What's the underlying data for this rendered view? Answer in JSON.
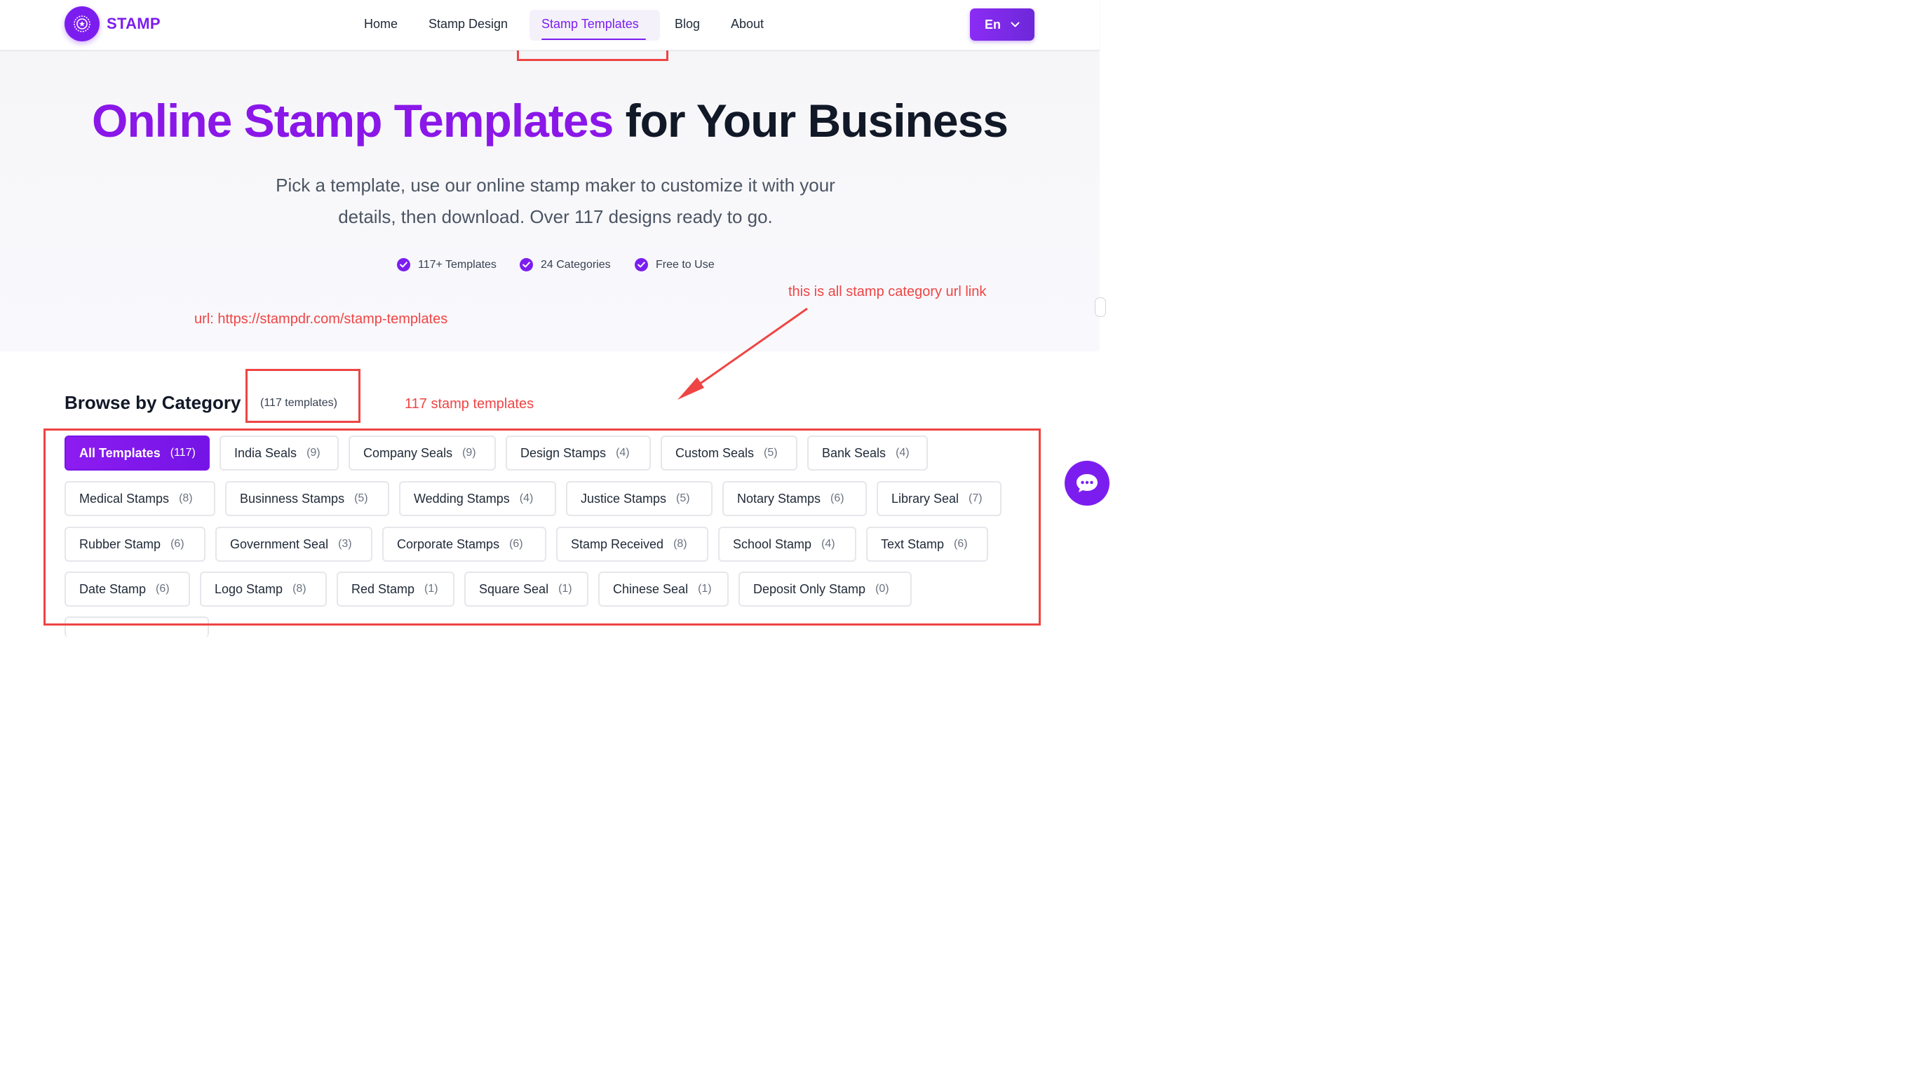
{
  "header": {
    "brand": "STAMP",
    "nav": [
      {
        "label": "Home"
      },
      {
        "label": "Stamp Design"
      },
      {
        "label": "Stamp Templates"
      },
      {
        "label": "Blog"
      },
      {
        "label": "About"
      }
    ],
    "language": "En"
  },
  "hero": {
    "title_accent": "Online Stamp Templates",
    "title_rest": "for Your Business",
    "subtitle": "Pick a template, use our online stamp maker to customize it with your details, then download. Over 117 designs ready to go.",
    "features": [
      "117+ Templates",
      "24 Categories",
      "Free to Use"
    ]
  },
  "annotations": {
    "url_note": "url: https://stampdr.com/stamp-templates",
    "category_note": "this is all stamp category url link",
    "count_note": "117 stamp templates"
  },
  "browse": {
    "title": "Browse by Category",
    "count": "(117 templates)",
    "categories": [
      {
        "label": "All Templates",
        "count": "(117)"
      },
      {
        "label": "India Seals",
        "count": "(9)"
      },
      {
        "label": "Company Seals",
        "count": "(9)"
      },
      {
        "label": "Design Stamps",
        "count": "(4)"
      },
      {
        "label": "Custom Seals",
        "count": "(5)"
      },
      {
        "label": "Bank Seals",
        "count": "(4)"
      },
      {
        "label": "Medical Stamps",
        "count": "(8)"
      },
      {
        "label": "Businness Stamps",
        "count": "(5)"
      },
      {
        "label": "Wedding Stamps",
        "count": "(4)"
      },
      {
        "label": "Justice Stamps",
        "count": "(5)"
      },
      {
        "label": "Notary Stamps",
        "count": "(6)"
      },
      {
        "label": "Library Seal",
        "count": "(7)"
      },
      {
        "label": "Rubber Stamp",
        "count": "(6)"
      },
      {
        "label": "Government Seal",
        "count": "(3)"
      },
      {
        "label": "Corporate Stamps",
        "count": "(6)"
      },
      {
        "label": "Stamp Received",
        "count": "(8)"
      },
      {
        "label": "School Stamp",
        "count": "(4)"
      },
      {
        "label": "Text Stamp",
        "count": "(6)"
      },
      {
        "label": "Date Stamp",
        "count": "(6)"
      },
      {
        "label": "Logo Stamp",
        "count": "(8)"
      },
      {
        "label": "Red Stamp",
        "count": "(1)"
      },
      {
        "label": "Square Seal",
        "count": "(1)"
      },
      {
        "label": "Chinese Seal",
        "count": "(1)"
      },
      {
        "label": "Deposit Only Stamp",
        "count": "(0)"
      }
    ]
  },
  "colors": {
    "accent": "#7c1df0",
    "annotation_red": "#ef4444"
  },
  "icons": {
    "logo": "stamp-logo-icon",
    "check": "check-circle-icon",
    "chevron": "chevron-down-icon",
    "chat": "chat-bubble-icon"
  }
}
